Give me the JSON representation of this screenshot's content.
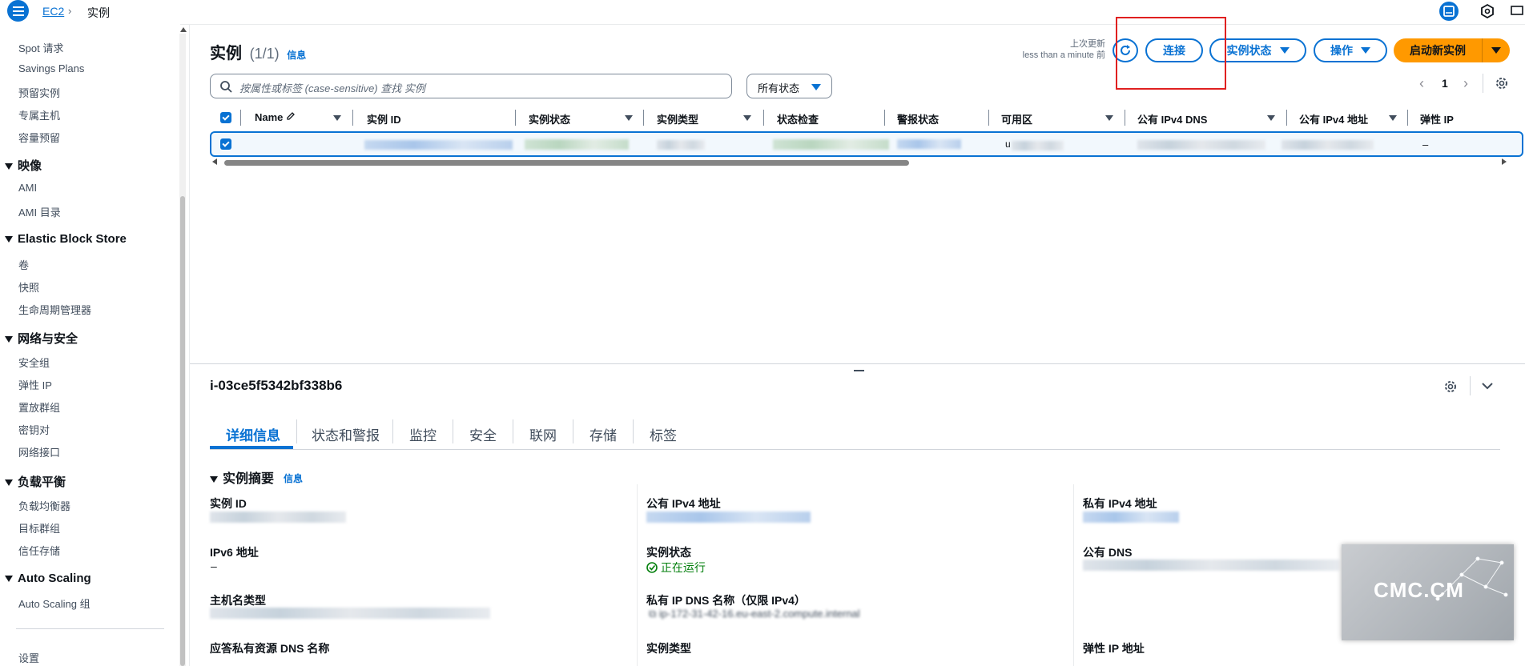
{
  "breadcrumb": {
    "service": "EC2",
    "current": "实例"
  },
  "sidebar": {
    "items_top": [
      "Spot 请求",
      "Savings Plans",
      "预留实例",
      "专属主机",
      "容量预留"
    ],
    "images": {
      "title": "映像",
      "items": [
        "AMI",
        "AMI 目录"
      ]
    },
    "ebs": {
      "title": "Elastic Block Store",
      "items": [
        "卷",
        "快照",
        "生命周期管理器"
      ]
    },
    "network": {
      "title": "网络与安全",
      "items": [
        "安全组",
        "弹性 IP",
        "置放群组",
        "密钥对",
        "网络接口"
      ]
    },
    "lb": {
      "title": "负载平衡",
      "items": [
        "负载均衡器",
        "目标群组",
        "信任存储"
      ]
    },
    "autoscaling": {
      "title": "Auto Scaling",
      "items": [
        "Auto Scaling 组"
      ]
    },
    "settings": "设置"
  },
  "instances": {
    "title": "实例",
    "count": "(1/1)",
    "info": "信息",
    "last_updated_label": "上次更新",
    "last_updated_value": "less than a minute 前",
    "buttons": {
      "connect": "连接",
      "instance_state": "实例状态",
      "actions": "操作",
      "launch": "启动新实例"
    },
    "search_placeholder": "按属性或标签 (case-sensitive) 查找 实例",
    "state_filter": "所有状态",
    "page": "1",
    "columns": [
      "Name",
      "实例 ID",
      "实例状态",
      "实例类型",
      "状态检查",
      "警报状态",
      "可用区",
      "公有 IPv4 DNS",
      "公有 IPv4 地址",
      "弹性 IP"
    ],
    "row": {
      "elastic_ip": "–",
      "az_prefix": "u"
    }
  },
  "detail": {
    "instance_id": "i-03ce5f5342bf338b6",
    "tabs": [
      "详细信息",
      "状态和警报",
      "监控",
      "安全",
      "联网",
      "存储",
      "标签"
    ],
    "summary_title": "实例摘要",
    "summary_info": "信息",
    "fields": {
      "instance_id": "实例 ID",
      "ipv6": "IPv6 地址",
      "ipv6_value": "–",
      "hostname_type": "主机名类型",
      "private_dns_name": "应答私有资源 DNS 名称",
      "public_ipv4": "公有 IPv4 地址",
      "state": "实例状态",
      "state_value": "正在运行",
      "private_ip_dns": "私有 IP DNS 名称（仅限 IPv4）",
      "private_ip_dns_value": "ip-172-31-42-16.eu-east-2.compute.internal",
      "instance_type": "实例类型",
      "private_ipv4": "私有 IPv4 地址",
      "public_dns": "公有 DNS",
      "elastic_ip": "弹性 IP 地址"
    }
  },
  "watermark": "CMC.CM",
  "colors": {
    "primary": "#0972d3",
    "launch": "#ff9900",
    "running": "#037f0c",
    "highlight": "#e02020"
  }
}
